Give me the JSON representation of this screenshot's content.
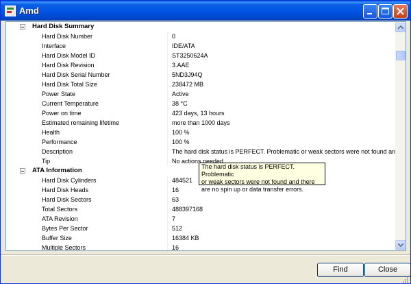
{
  "window": {
    "title": "Amd",
    "icons": {
      "app": "disk-info-app-icon",
      "minimize": "minimize-icon",
      "maximize": "maximize-icon",
      "close": "close-icon"
    },
    "colors": {
      "titlebar": "#0054e3",
      "close_button": "#c4401d",
      "tooltip_bg": "#ffffe1"
    }
  },
  "sections": [
    {
      "title": "Hard Disk Summary",
      "rows": [
        {
          "key": "Hard Disk Number",
          "value": "0"
        },
        {
          "key": "Interface",
          "value": "IDE/ATA"
        },
        {
          "key": "Hard Disk Model ID",
          "value": "ST3250624A"
        },
        {
          "key": "Hard Disk Revision",
          "value": "3.AAE"
        },
        {
          "key": "Hard Disk Serial Number",
          "value": "5ND3J94Q"
        },
        {
          "key": "Hard Disk Total Size",
          "value": "238472 MB"
        },
        {
          "key": "Power State",
          "value": "Active"
        },
        {
          "key": "Current Temperature",
          "value": "38 °C"
        },
        {
          "key": "Power on time",
          "value": "423 days, 13 hours"
        },
        {
          "key": "Estimated remaining lifetime",
          "value": "more than 1000 days"
        },
        {
          "key": "Health",
          "value": "100 %"
        },
        {
          "key": "Performance",
          "value": "100 %"
        },
        {
          "key": "Description",
          "value": "The hard disk status is PERFECT. Problematic or weak sectors were not found and there"
        },
        {
          "key": "Tip",
          "value": "No actions needed"
        }
      ]
    },
    {
      "title": "ATA Information",
      "rows": [
        {
          "key": "Hard Disk Cylinders",
          "value": "484521"
        },
        {
          "key": "Hard Disk Heads",
          "value": "16"
        },
        {
          "key": "Hard Disk Sectors",
          "value": "63"
        },
        {
          "key": "Total Sectors",
          "value": "488397168"
        },
        {
          "key": "ATA Revision",
          "value": "7"
        },
        {
          "key": "Bytes Per Sector",
          "value": "512"
        },
        {
          "key": "Buffer Size",
          "value": "16384 KB"
        },
        {
          "key": "Multiple Sectors",
          "value": "16"
        }
      ]
    }
  ],
  "tooltip": {
    "text": "The hard disk status is PERFECT. Problematic\nor weak sectors were not found and there\nare no spin up or data transfer errors."
  },
  "buttons": {
    "find": "Find",
    "close": "Close"
  }
}
